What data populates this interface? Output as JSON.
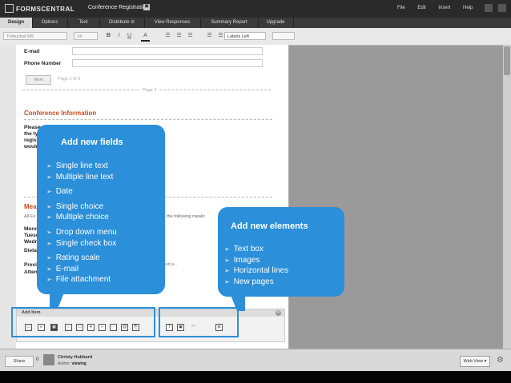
{
  "app": {
    "logo": "FORMSCENTRAL",
    "doc_title": "Conference Registration",
    "close_glyph": "✖"
  },
  "menu": [
    "File",
    "Edit",
    "Insert",
    "Help"
  ],
  "tabs": [
    "Design",
    "Options",
    "Text",
    "Distribute ⊖",
    "View Responses",
    "Summary Report",
    "Upgrade"
  ],
  "toolbar": {
    "font": "Trebuchet MS",
    "size": "14",
    "bold": "B",
    "italic": "I",
    "underline": "U",
    "color": "A",
    "labels": "Labels Left"
  },
  "form": {
    "email_label": "E-mail",
    "phone_label": "Phone Number",
    "next": "Next",
    "page_of": "Page 1 of 2",
    "page2": "Page 2",
    "section_title": "Conference Information",
    "please_lines": [
      "Please sel",
      "the type of",
      "registratio",
      "would you"
    ],
    "meals_title": "Mea",
    "meals_text": "All Fu",
    "meals_right": "the following meals:",
    "days": [
      "Monda",
      "Tuesd",
      "Wedn"
    ],
    "dietary": "Dieta",
    "previous": "Previ",
    "attendee": "Attendee",
    "previous_right": "that you attended a..."
  },
  "add_panel": {
    "title": "Add Item",
    "close": "✕"
  },
  "callout_fields": {
    "title": "Add new fields",
    "items": [
      "Single line text",
      "Multiple line text",
      "Date",
      "Single choice",
      "Multiple choice",
      "Drop down menu",
      "Single check box",
      "Rating scale",
      "E-mail",
      "File attachment"
    ]
  },
  "callout_elements": {
    "title": "Add new elements",
    "items": [
      "Text box",
      "Images",
      "Horizontal lines",
      "New pages"
    ]
  },
  "bottom": {
    "share": "Share",
    "count": "0",
    "author_name": "Christy Hubbard",
    "author_prefix": "Author:",
    "author_status": "viewing",
    "web_view": "Web View ▾",
    "gear": "⚙"
  },
  "colors": {
    "accent": "#2b8fd9",
    "section": "#c84a1b"
  }
}
